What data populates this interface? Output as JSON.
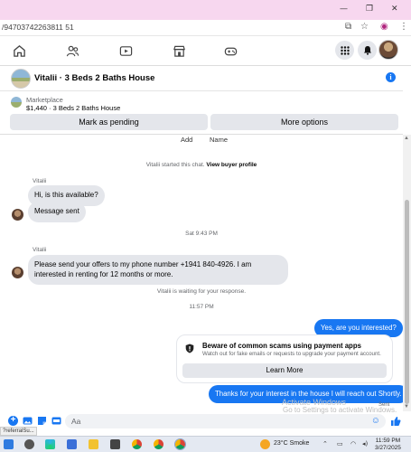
{
  "browser": {
    "url": "/94703742263811 51",
    "window_controls": [
      "—",
      "❐",
      "✕"
    ]
  },
  "chat": {
    "title": "Vitalii · 3 Beds 2 Baths House",
    "info_icon": "i"
  },
  "listing": {
    "label": "Marketplace",
    "price": "$1,440 · 3 Beds 2 Baths House",
    "mark_pending_label": "Mark as pending",
    "more_options_label": "More options"
  },
  "header_row": {
    "add": "Add",
    "name": "Name"
  },
  "conversation": {
    "started_text": "Vitalii started this chat. ",
    "view_profile": "View buyer profile",
    "sender_1": "Vitalii",
    "msg_1": "Hi, is this available?",
    "msg_2": "Message sent",
    "stamp_1": "Sat 9:43 PM",
    "sender_2": "Vitalii",
    "msg_3": "Please send your offers to my phone number +1941 840-4926. I am interested in renting for 12 months or more.",
    "waiting": "Vitalii is waiting for your response.",
    "stamp_2": "11:57 PM",
    "out_1": "Yes, are you interested?",
    "scam_title": "Beware of common scams using payment apps",
    "scam_desc": "Watch out for fake emails or requests to upgrade your payment account.",
    "learn_more": "Learn More",
    "out_2": "Thanks for your interest in the house I will reach out Shortly.",
    "sent": "Sent"
  },
  "composer": {
    "placeholder": "Aa"
  },
  "watermark": {
    "line1": "Activate Windows",
    "line2": "Go to Settings to activate Windows."
  },
  "status_url": "?referralSu...",
  "taskbar": {
    "weather": "23°C  Smoke",
    "time": "11:59 PM",
    "date": "3/27/2025"
  },
  "colors": {
    "accent": "#1877f2",
    "bubble_in": "#e4e6eb",
    "titlebar": "#f7d7ef"
  }
}
